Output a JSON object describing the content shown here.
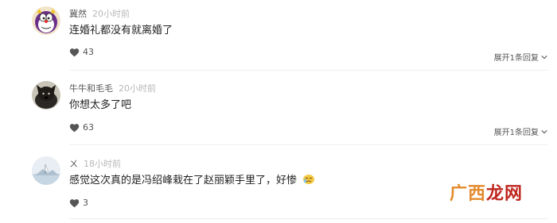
{
  "comments": [
    {
      "username": "冀然",
      "time": "20小时前",
      "text": "连婚礼都没有就离婚了",
      "likes": "43",
      "reply_toggle": "展开1条回复",
      "avatar": "doraemon-avatar"
    },
    {
      "username": "牛牛和毛毛",
      "time": "20小时前",
      "text": "你想太多了吧",
      "likes": "63",
      "reply_toggle": "展开1条回复",
      "avatar": "dog-avatar"
    },
    {
      "username": "ㄨ",
      "time": "18小时前",
      "text": "感觉这次真的是冯绍峰栽在了赵丽颖手里了，好惨",
      "emoji": "crying-emoji",
      "likes": "3",
      "avatar": "landscape-avatar"
    }
  ],
  "watermark": {
    "part1": "广西",
    "part2": "龙网"
  },
  "colors": {
    "time": "#b8b8b8",
    "text": "#222222",
    "divider": "#eeeeee",
    "watermark_orange": "#e38a2c",
    "watermark_red": "#c0271f"
  }
}
